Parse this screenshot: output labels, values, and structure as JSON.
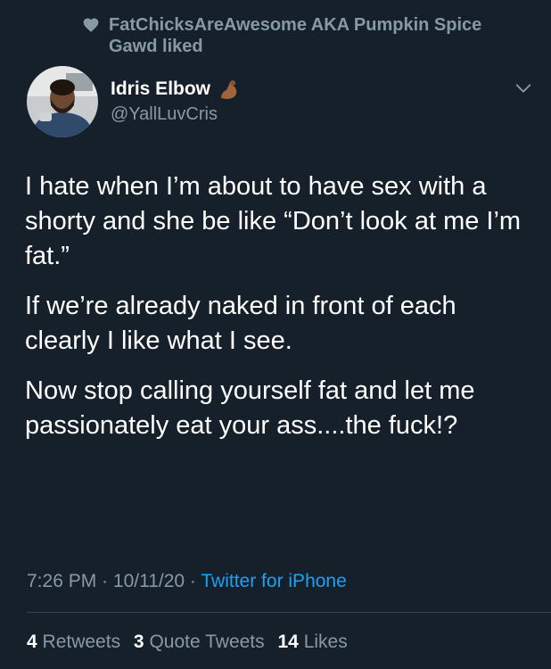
{
  "social_context": {
    "text": "FatChicksAreAwesome AKA Pumpkin Spice Gawd liked",
    "icon": "heart-icon"
  },
  "author": {
    "name": "Idris Elbow",
    "name_emoji": "flexed-biceps-icon",
    "handle": "@YallLuvCris",
    "menu_icon": "chevron-down-icon"
  },
  "tweet": {
    "paragraphs": [
      "I hate when I’m about to have sex with a shorty and she be like “Don’t look at me I’m fat.”",
      "If we’re already naked in front of each clearly I like what I see.",
      "Now stop calling yourself fat and let me passionately eat your ass....the fuck!?"
    ]
  },
  "meta": {
    "time": "7:26 PM",
    "date": "10/11/20",
    "separator": " · ",
    "source": "Twitter for iPhone"
  },
  "stats": {
    "retweets_count": "4",
    "retweets_label": "Retweets",
    "quotes_count": "3",
    "quotes_label": "Quote Tweets",
    "likes_count": "14",
    "likes_label": "Likes"
  },
  "colors": {
    "background": "#15202b",
    "text": "#ffffff",
    "secondary_text": "#8899a6",
    "link": "#1da1f2",
    "divider": "#38444d"
  }
}
